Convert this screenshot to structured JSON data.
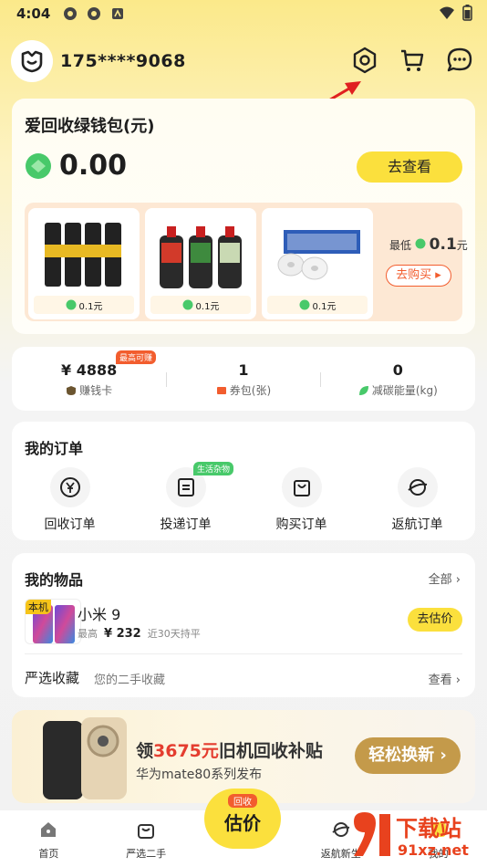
{
  "status_bar": {
    "time": "4:04"
  },
  "header": {
    "phone": "175****9068"
  },
  "wallet": {
    "title": "爱回收绿钱包(元)",
    "amount": "0.00",
    "view_button": "去查看",
    "products": [
      {
        "price": "0.1元"
      },
      {
        "price": "0.1元"
      },
      {
        "price": "0.1元"
      }
    ],
    "lowest_prefix": "最低",
    "lowest_value": "0.1",
    "lowest_unit": "元",
    "buy_button": "去购买"
  },
  "stats": {
    "earn_value": "¥ 4888",
    "earn_badge": "最高可赚",
    "earn_label": "赚钱卡",
    "coupon_value": "1",
    "coupon_label": "券包(张)",
    "carbon_value": "0",
    "carbon_label": "减碳能量(kg)"
  },
  "orders": {
    "title": "我的订单",
    "items": [
      {
        "label": "回收订单"
      },
      {
        "label": "投递订单",
        "badge": "生活杂物"
      },
      {
        "label": "购买订单"
      },
      {
        "label": "返航订单"
      }
    ]
  },
  "items": {
    "title": "我的物品",
    "all_link": "全部",
    "device_tag": "本机",
    "device_name": "小米 9",
    "price_prefix": "最高",
    "price_value": "¥ 232",
    "price_suffix": "近30天持平",
    "estimate_button": "去估价",
    "fav_label": "严选收藏",
    "fav_sub": "您的二手收藏",
    "fav_link": "查看"
  },
  "banner": {
    "title_prefix": "领",
    "title_highlight": "3675元",
    "title_suffix": "旧机回收补贴",
    "subtitle": "华为mate80系列发布",
    "button": "轻松换新"
  },
  "tabbar": {
    "tabs": [
      {
        "label": "首页"
      },
      {
        "label": "严选二手"
      },
      {
        "label": "返航新生"
      },
      {
        "label": "我的"
      }
    ],
    "center_tag": "回收",
    "center_label": "估价"
  },
  "watermark": {
    "line1": "下载站",
    "line2": "91xz.net"
  },
  "colors": {
    "accent_yellow": "#fbe03d",
    "accent_red": "#f25d2e",
    "green": "#48c96a"
  }
}
